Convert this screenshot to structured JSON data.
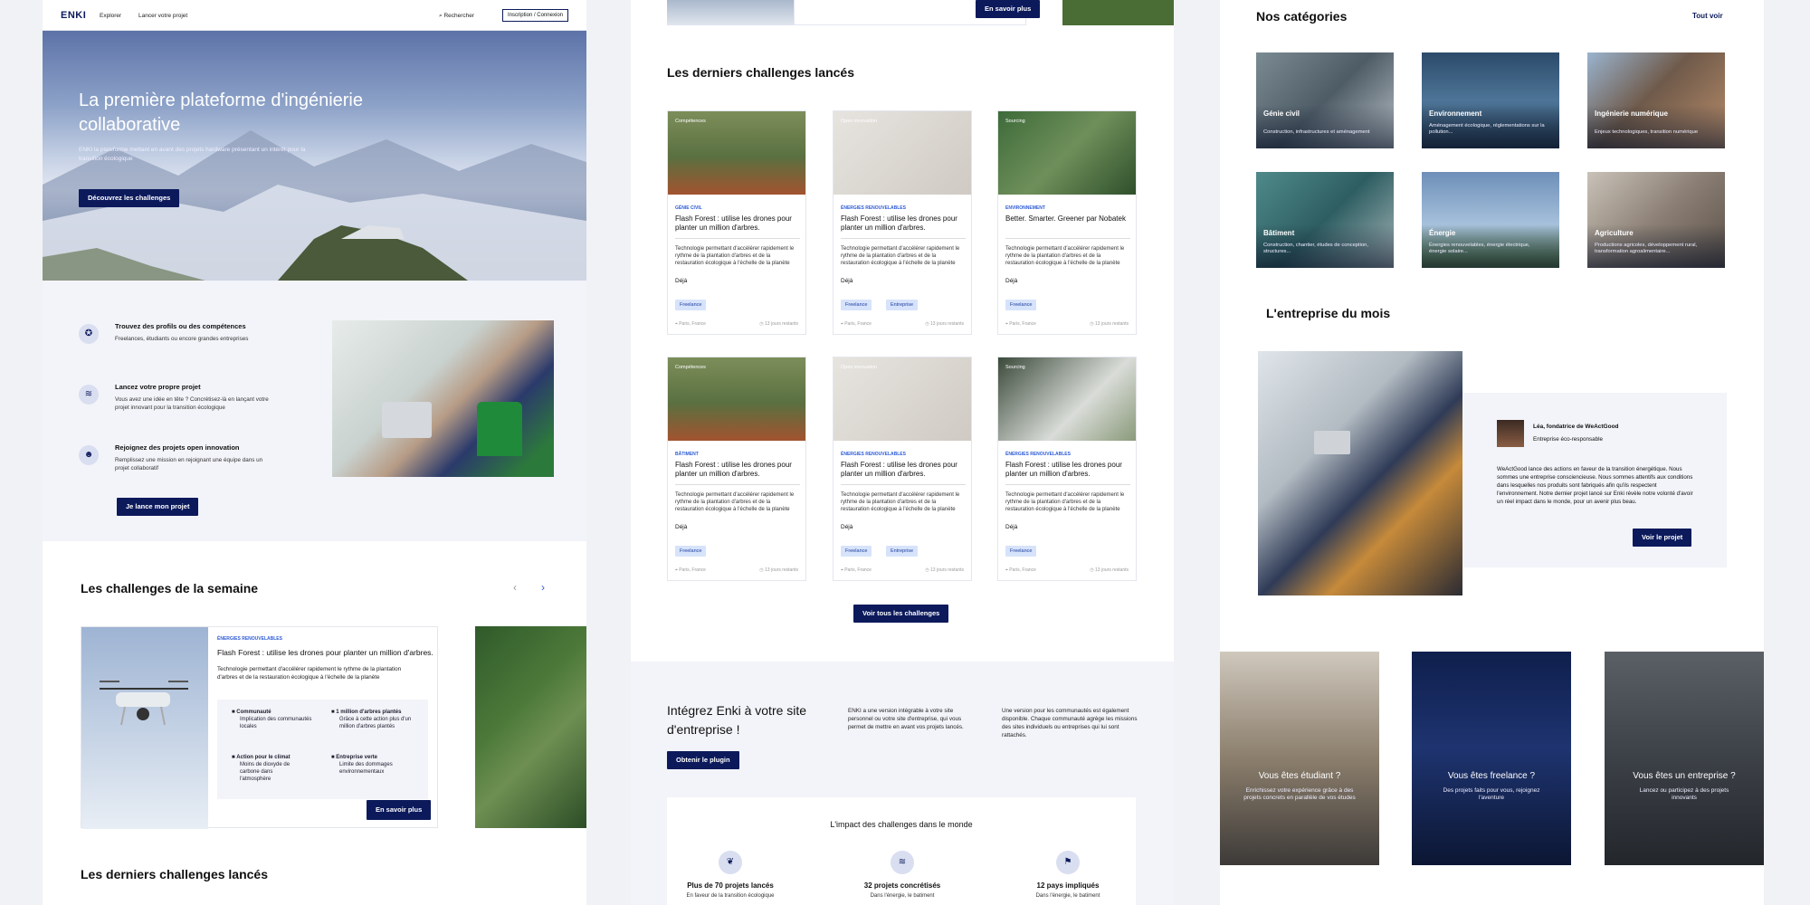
{
  "nav": {
    "logo": "ENKI",
    "explorer": "Explorer",
    "launch": "Lancer votre projet",
    "search": "Rechercher",
    "login": "Inscription / Connexion"
  },
  "hero": {
    "title": "La première plateforme d'ingénierie collaborative",
    "subtitle": "ENKI la plateforme mettant en avant des projets hardware présentant un intérêt pour la transition écologique",
    "cta": "Découvrez les challenges"
  },
  "features": [
    {
      "title": "Trouvez des profils ou des compétences",
      "desc": "Freelances, étudiants ou encore grandes entreprises"
    },
    {
      "title": "Lancez votre propre projet",
      "desc": "Vous avez une idée en tête ? Concrétisez-là en lançant votre projet innovant pour la transition écologique"
    },
    {
      "title": "Rejoignez des projets open innovation",
      "desc": "Remplissez une mission en rejoignant une équipe dans un projet collaboratif"
    }
  ],
  "features_cta": "Je lance mon projet",
  "weekly": {
    "heading": "Les challenges de la semaine",
    "category": "ÉNERGIES RENOUVELABLES",
    "title": "Flash Forest : utilise les drones pour planter un million d'arbres.",
    "desc": "Technologie permettant d'accélérer rapidement le rythme de la plantation d'arbres et de la restauration écologique à l'échelle de la planète",
    "impacts": [
      {
        "t": "Communauté",
        "d": "Implication des communautés locales"
      },
      {
        "t": "1 million d'arbres plantés",
        "d": "Grâce à cette action plus d'un million d'arbres plantés"
      },
      {
        "t": "Action pour le climat",
        "d": "Moins de dioxyde de carbone dans l'atmosphère"
      },
      {
        "t": "Entreprise verte",
        "d": "Limite des dommages environnementaux"
      }
    ],
    "cta": "En savoir plus"
  },
  "latest_heading": "Les derniers challenges lancés",
  "p2_top_cta": "En savoir plus",
  "cards": [
    {
      "tag": "Compétences",
      "cat": "GÉNIE CIVIL",
      "title": "Flash Forest : utilise les drones pour planter un million d'arbres.",
      "desc": "Technologie permettant d'accélérer rapidement le rythme de la plantation d'arbres et de la restauration écologique à l'échelle de la planète",
      "deja": "Déjà",
      "chips": [
        "Freelance"
      ],
      "loc": "Paris, France",
      "rem": "13 jours restants"
    },
    {
      "tag": "Open innovation",
      "cat": "ÉNERGIES RENOUVELABLES",
      "title": "Flash Forest : utilise les drones pour planter un million d'arbres.",
      "desc": "Technologie permettant d'accélérer rapidement le rythme de la plantation d'arbres et de la restauration écologique à l'échelle de la planète",
      "deja": "Déjà",
      "chips": [
        "Freelance",
        "Entreprise"
      ],
      "loc": "Paris, France",
      "rem": "13 jours restants"
    },
    {
      "tag": "Sourcing",
      "cat": "ENVIRONNEMENT",
      "title": "Better. Smarter. Greener par Nobatek",
      "desc": "Technologie permettant d'accélérer rapidement le rythme de la plantation d'arbres et de la restauration écologique à l'échelle de la planète",
      "deja": "Déjà",
      "chips": [
        "Freelance"
      ],
      "loc": "Paris, France",
      "rem": "13 jours restants"
    },
    {
      "tag": "Compétences",
      "cat": "BÂTIMENT",
      "title": "Flash Forest : utilise les drones pour planter un million d'arbres.",
      "desc": "Technologie permettant d'accélérer rapidement le rythme de la plantation d'arbres et de la restauration écologique à l'échelle de la planète",
      "deja": "Déjà",
      "chips": [
        "Freelance"
      ],
      "loc": "Paris, France",
      "rem": "13 jours restants"
    },
    {
      "tag": "Open innovation",
      "cat": "ÉNERGIES RENOUVELABLES",
      "title": "Flash Forest : utilise les drones pour planter un million d'arbres.",
      "desc": "Technologie permettant d'accélérer rapidement le rythme de la plantation d'arbres et de la restauration écologique à l'échelle de la planète",
      "deja": "Déjà",
      "chips": [
        "Freelance",
        "Entreprise"
      ],
      "loc": "Paris, France",
      "rem": "13 jours restants"
    },
    {
      "tag": "Sourcing",
      "cat": "ÉNERGIES RENOUVELABLES",
      "title": "Flash Forest : utilise les drones pour planter un million d'arbres.",
      "desc": "Technologie permettant d'accélérer rapidement le rythme de la plantation d'arbres et de la restauration écologique à l'échelle de la planète",
      "deja": "Déjà",
      "chips": [
        "Freelance"
      ],
      "loc": "Paris, France",
      "rem": "13 jours restants"
    }
  ],
  "see_all_challenges": "Voir tous les challenges",
  "integrate": {
    "title": "Intégrez Enki à votre site d'entreprise !",
    "cta": "Obtenir le plugin",
    "col1": "ENKI a une version intégrable à votre site personnel ou votre site d'entreprise, qui vous permet de mettre en avant vos projets lancés.",
    "col2": "Une version pour les communautés est également disponible. Chaque communauté agrège les missions des sites individuels ou entreprises qui lui sont rattachés."
  },
  "impact": {
    "heading": "L'impact des challenges dans le monde",
    "stats": [
      {
        "n": "Plus de 70 projets lancés",
        "d": "En faveur de la transition écologique"
      },
      {
        "n": "32 projets concrétisés",
        "d": "Dans l'énergie, le batiment"
      },
      {
        "n": "12 pays impliqués",
        "d": "Dans l'énergie, le batiment"
      }
    ]
  },
  "categories": {
    "heading": "Nos catégories",
    "see_all": "Tout voir",
    "items": [
      {
        "name": "Génie civil",
        "desc": "Construction, infrastructures et aménagement"
      },
      {
        "name": "Environnement",
        "desc": "Aménagement écologique, réglementations sur la pollution..."
      },
      {
        "name": "Ingénierie numérique",
        "desc": "Enjeux technologiques, transition numérique"
      },
      {
        "name": "Bâtiment",
        "desc": "Construction, chantier, études de conception, structures..."
      },
      {
        "name": "Énergie",
        "desc": "Énergies renouvelables, énergie électrique, énergie solaire..."
      },
      {
        "name": "Agriculture",
        "desc": "Productions agricoles, développement rural, transformation agroalimentaire..."
      }
    ]
  },
  "company": {
    "heading": "L'entreprise du mois",
    "person": "Léa, fondatrice de WeActGood",
    "role": "Entreprise éco-responsable",
    "desc": "WeActGood lance des actions en faveur de la transition énergétique. Nous sommes une entreprise consciencieuse. Nous sommes attentifs aux conditions dans lesquelles nos produits sont fabriqués afin qu'ils respectent l'environnement. Notre dernier projet lancé sur Enki révèle notre volonté d'avoir un réel impact dans le monde, pour un avenir plus beau.",
    "cta": "Voir le projet"
  },
  "audiences": [
    {
      "t": "Vous êtes étudiant ?",
      "d": "Enrichissez votre expérience grâce à des projets concrets en parallèle de vos études"
    },
    {
      "t": "Vous êtes freelance ?",
      "d": "Des projets faits pour vous, rejoignez l'aventure"
    },
    {
      "t": "Vous êtes un entreprise ?",
      "d": "Lancez ou participez à des projets innovants"
    }
  ],
  "colors": {
    "navy": "#0c1a5c",
    "accent_blue": "#2d5bd6",
    "chip_bg": "#d7e3fb",
    "section_bg": "#f3f4f9"
  }
}
